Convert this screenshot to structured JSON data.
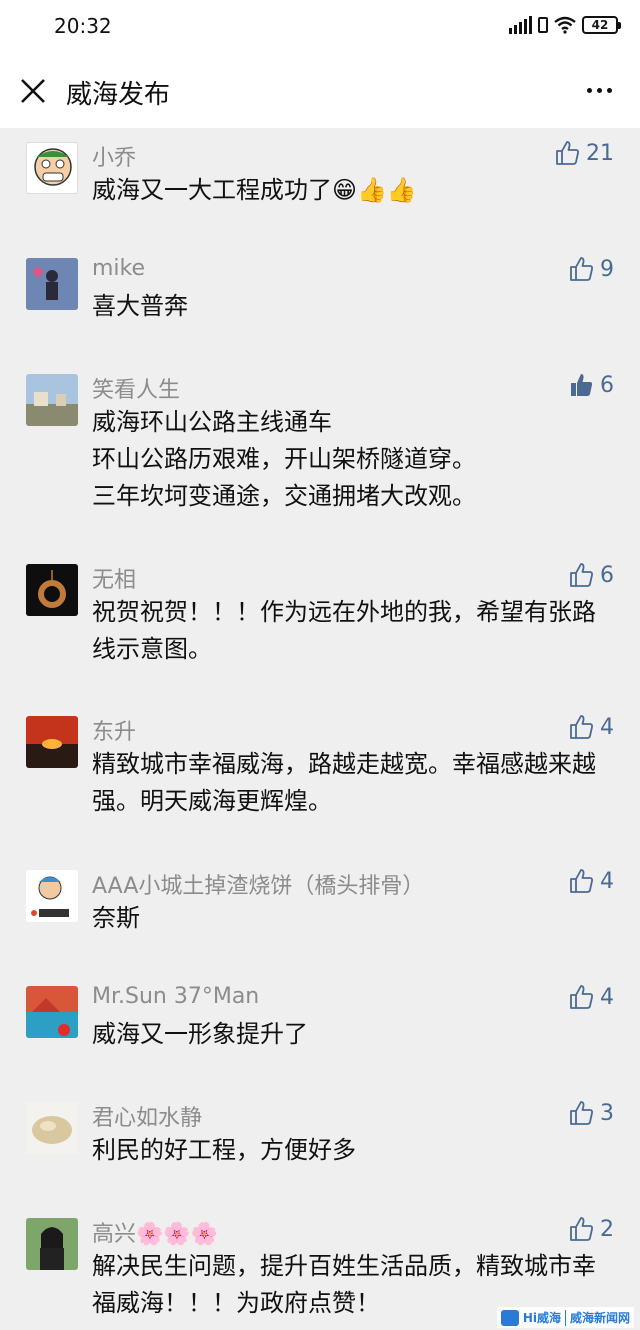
{
  "status_bar": {
    "time": "20:32",
    "battery": "42"
  },
  "header": {
    "title": "威海发布"
  },
  "comments": [
    {
      "name": "小乔",
      "text": "威海又一大工程成功了😁👍👍",
      "likes": "21",
      "liked": false
    },
    {
      "name": "mike",
      "text": "喜大普奔",
      "likes": "9",
      "liked": false
    },
    {
      "name": "笑看人生",
      "text": "威海环山公路主线通车\n环山公路历艰难，开山架桥隧道穿。\n三年坎坷变通途，交通拥堵大改观。",
      "likes": "6",
      "liked": true
    },
    {
      "name": "无相",
      "text": "祝贺祝贺！！！作为远在外地的我，希望有张路线示意图。",
      "likes": "6",
      "liked": false
    },
    {
      "name": "东升",
      "text": "精致城市幸福威海，路越走越宽。幸福感越来越强。明天威海更辉煌。",
      "likes": "4",
      "liked": false
    },
    {
      "name": "AAA小城土掉渣烧饼（橋头排骨）",
      "text": "奈斯",
      "likes": "4",
      "liked": false
    },
    {
      "name": "Mr.Sun 37°Man",
      "text": "威海又一形象提升了",
      "likes": "4",
      "liked": false
    },
    {
      "name": "君心如水静",
      "text": "利民的好工程，方便好多",
      "likes": "3",
      "liked": false
    },
    {
      "name": "高兴🌸🌸🌸",
      "text": "解决民生问题，提升百姓生活品质，精致城市幸福威海！！！为政府点赞！",
      "likes": "2",
      "liked": false
    }
  ],
  "watermark": {
    "left": "Hi威海",
    "right": "威海新闻网"
  },
  "colors": {
    "accent": "#4a6a93",
    "name_gray": "#8c8c8c",
    "background": "#efefef"
  }
}
